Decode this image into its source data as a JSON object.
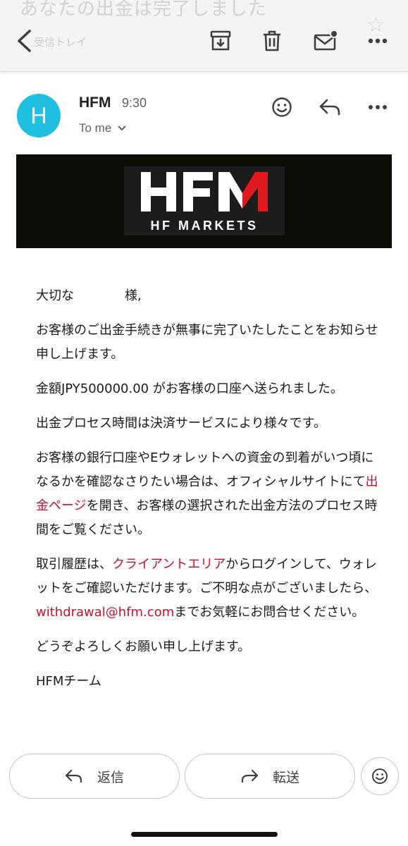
{
  "toolbar": {
    "ghost_subject": "あなたの出金は完了しました",
    "ghost_folder": "受信トレイ",
    "icons": [
      "back-arrow-icon",
      "archive-icon",
      "trash-icon",
      "mail-unread-icon",
      "more-icon"
    ]
  },
  "sender": {
    "avatar_letter": "H",
    "name": "HFM",
    "time": "9:30",
    "to": "To me",
    "avatar_color": "#1fbfe0"
  },
  "banner": {
    "logo_main": "HFM",
    "logo_sub": "HF MARKETS",
    "accent": "#e0191e"
  },
  "body": {
    "greeting": "大切な　　　　様,",
    "p1": "お客様のご出金手続きが無事に完了いたしたことをお知らせ申し上げます。",
    "p2": "金額JPY500000.00 がお客様の口座へ送られました。",
    "p3": "出金プロセス時間は決済サービスにより様々です。",
    "p4_a": "お客様の銀行口座やEウォレットへの資金の到着がいつ頃になるかを確認なさりたい場合は、オフィシャルサイトにて",
    "p4_link": "出金ページ",
    "p4_b": "を開き、お客様の選択された出金方法のプロセス時間をご覧ください。",
    "p5_a": "取引履歴は、",
    "p5_link1": "クライアントエリア",
    "p5_b": "からログインして、ウォレットをご確認いただけます。ご不明な点がございましたら、 ",
    "p5_link2": "withdrawal@hfm.com",
    "p5_c": "までお気軽にお問合せください。",
    "p6": "どうぞよろしくお願い申し上げます。",
    "signature": "HFMチーム",
    "link_color": "#c8102e"
  },
  "actions": {
    "reply_label": "返信",
    "forward_label": "転送"
  }
}
